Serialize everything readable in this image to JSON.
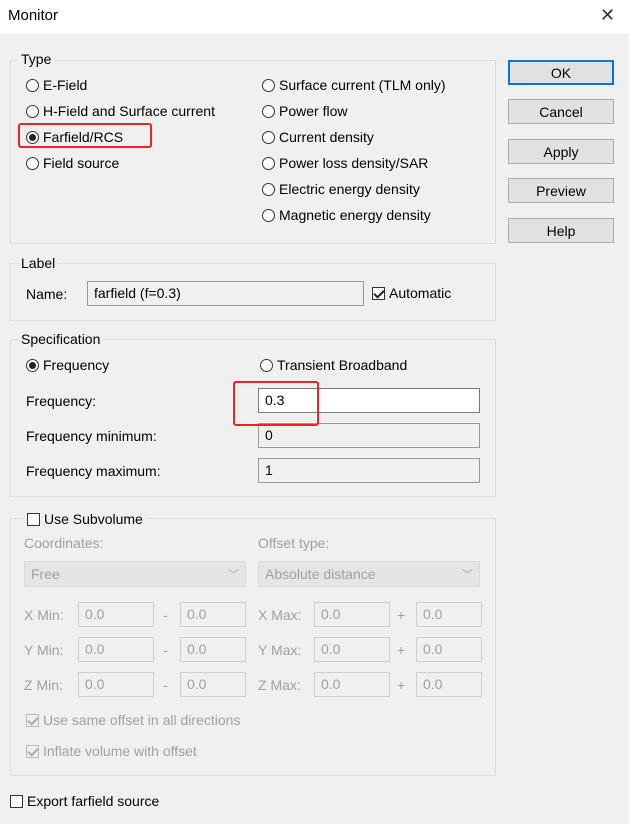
{
  "window": {
    "title": "Monitor",
    "close_glyph": "✕"
  },
  "type_group": {
    "legend": "Type",
    "left": [
      "E-Field",
      "H-Field and Surface current",
      "Farfield/RCS",
      "Field source"
    ],
    "right": [
      "Surface current (TLM only)",
      "Power flow",
      "Current density",
      "Power loss density/SAR",
      "Electric energy density",
      "Magnetic energy density"
    ],
    "selected": "Farfield/RCS"
  },
  "buttons": [
    "OK",
    "Cancel",
    "Apply",
    "Preview",
    "Help"
  ],
  "label_group": {
    "legend": "Label",
    "name_label": "Name:",
    "name_value": "farfield (f=0.3)",
    "automatic_label": "Automatic",
    "automatic_checked": true
  },
  "spec_group": {
    "legend": "Specification",
    "radio_frequency": "Frequency",
    "radio_transient": "Transient Broadband",
    "frequency_label": "Frequency:",
    "frequency_value": "0.3",
    "freq_min_label": "Frequency minimum:",
    "freq_min_value": "0",
    "freq_max_label": "Frequency maximum:",
    "freq_max_value": "1"
  },
  "subvolume_group": {
    "legend": "Use Subvolume",
    "checked": false,
    "coordinates_label": "Coordinates:",
    "coordinates_value": "Free",
    "offset_type_label": "Offset type:",
    "offset_type_value": "Absolute distance",
    "minus": "-",
    "plus": "+",
    "rows": [
      {
        "min_label": "X Min:",
        "min": "0.0",
        "min_offset": "0.0",
        "max_label": "X Max:",
        "max": "0.0",
        "max_offset": "0.0"
      },
      {
        "min_label": "Y Min:",
        "min": "0.0",
        "min_offset": "0.0",
        "max_label": "Y Max:",
        "max": "0.0",
        "max_offset": "0.0"
      },
      {
        "min_label": "Z Min:",
        "min": "0.0",
        "min_offset": "0.0",
        "max_label": "Z Max:",
        "max": "0.0",
        "max_offset": "0.0"
      }
    ],
    "same_offset_label": "Use same offset in all directions",
    "inflate_label": "Inflate volume with offset"
  },
  "export_label": "Export farfield source",
  "colors": {
    "highlight": "#e8262a",
    "default_button": "#0078d7"
  }
}
